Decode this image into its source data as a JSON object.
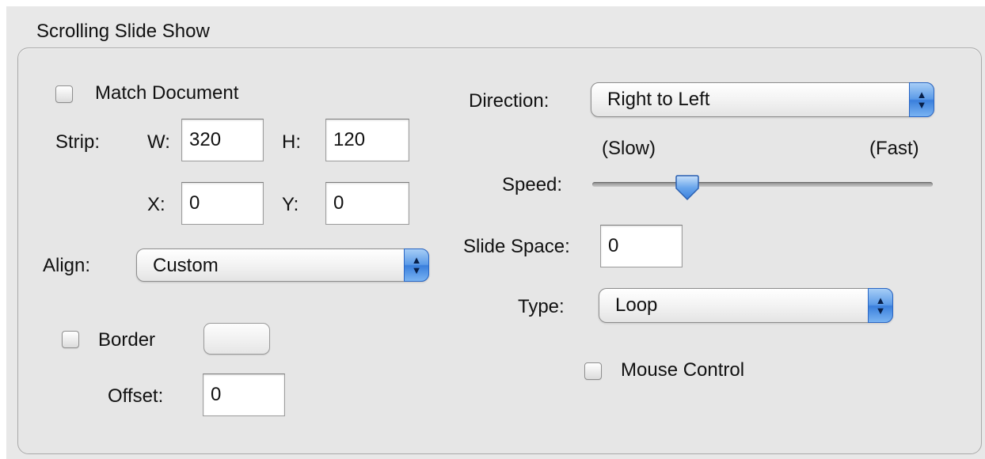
{
  "panel": {
    "title": "Scrolling Slide Show"
  },
  "left": {
    "match_document_label": "Match Document",
    "match_document_checked": false,
    "strip_label": "Strip:",
    "w_label": "W:",
    "w_value": "320",
    "h_label": "H:",
    "h_value": "120",
    "x_label": "X:",
    "x_value": "0",
    "y_label": "Y:",
    "y_value": "0",
    "align_label": "Align:",
    "align_value": "Custom",
    "border_label": "Border",
    "border_checked": false,
    "offset_label": "Offset:",
    "offset_value": "0"
  },
  "right": {
    "direction_label": "Direction:",
    "direction_value": "Right to Left",
    "slow_label": "(Slow)",
    "fast_label": "(Fast)",
    "speed_label": "Speed:",
    "speed_level": 0.28,
    "slide_space_label": "Slide Space:",
    "slide_space_value": "0",
    "type_label": "Type:",
    "type_value": "Loop",
    "mouse_control_label": "Mouse Control",
    "mouse_control_checked": false
  },
  "colors": {
    "panel_bg": "#e6e6e6",
    "accent_blue": "#3a7fdc"
  },
  "icons": {
    "popup_arrows": "up-down-arrows-icon",
    "slider_thumb": "slider-thumb-icon"
  }
}
